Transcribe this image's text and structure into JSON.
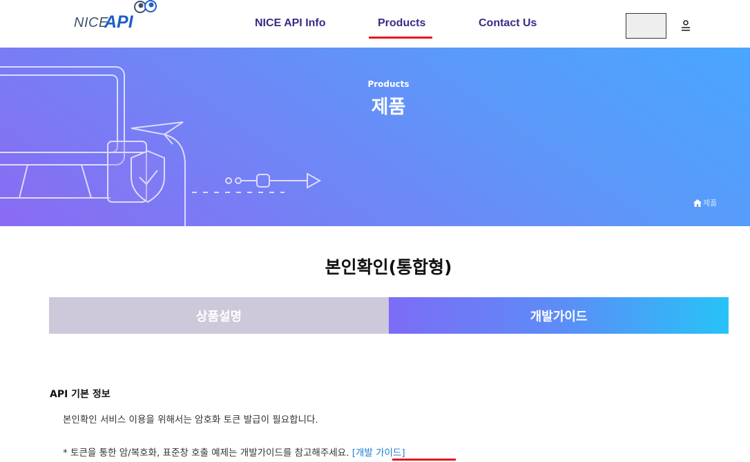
{
  "header": {
    "logo_nice": "NICE",
    "logo_api": "API",
    "nav": [
      {
        "label": "NICE API Info"
      },
      {
        "label": "Products"
      },
      {
        "label": "Contact Us"
      }
    ],
    "active_nav": "Products",
    "accent_color": "#e8161b",
    "nav_color": "#3a2a86"
  },
  "banner": {
    "subtitle": "Products",
    "title": "제품",
    "breadcrumb": "제품"
  },
  "product": {
    "title": "본인확인(통합형)"
  },
  "tabs": [
    {
      "label": "상품설명",
      "active": false
    },
    {
      "label": "개발가이드",
      "active": true
    }
  ],
  "content": {
    "heading": "API 기본 정보",
    "para1": "본인확인 서비스 이용을 위해서는 암호화 토큰 발급이 필요합니다.",
    "para2": "* 토큰을 통한 암/복호화, 표준창 호출 예제는 개발가이드를 참고해주세요. ",
    "guide_link": "[개발 가이드]",
    "link_color": "#1e7bd8"
  }
}
